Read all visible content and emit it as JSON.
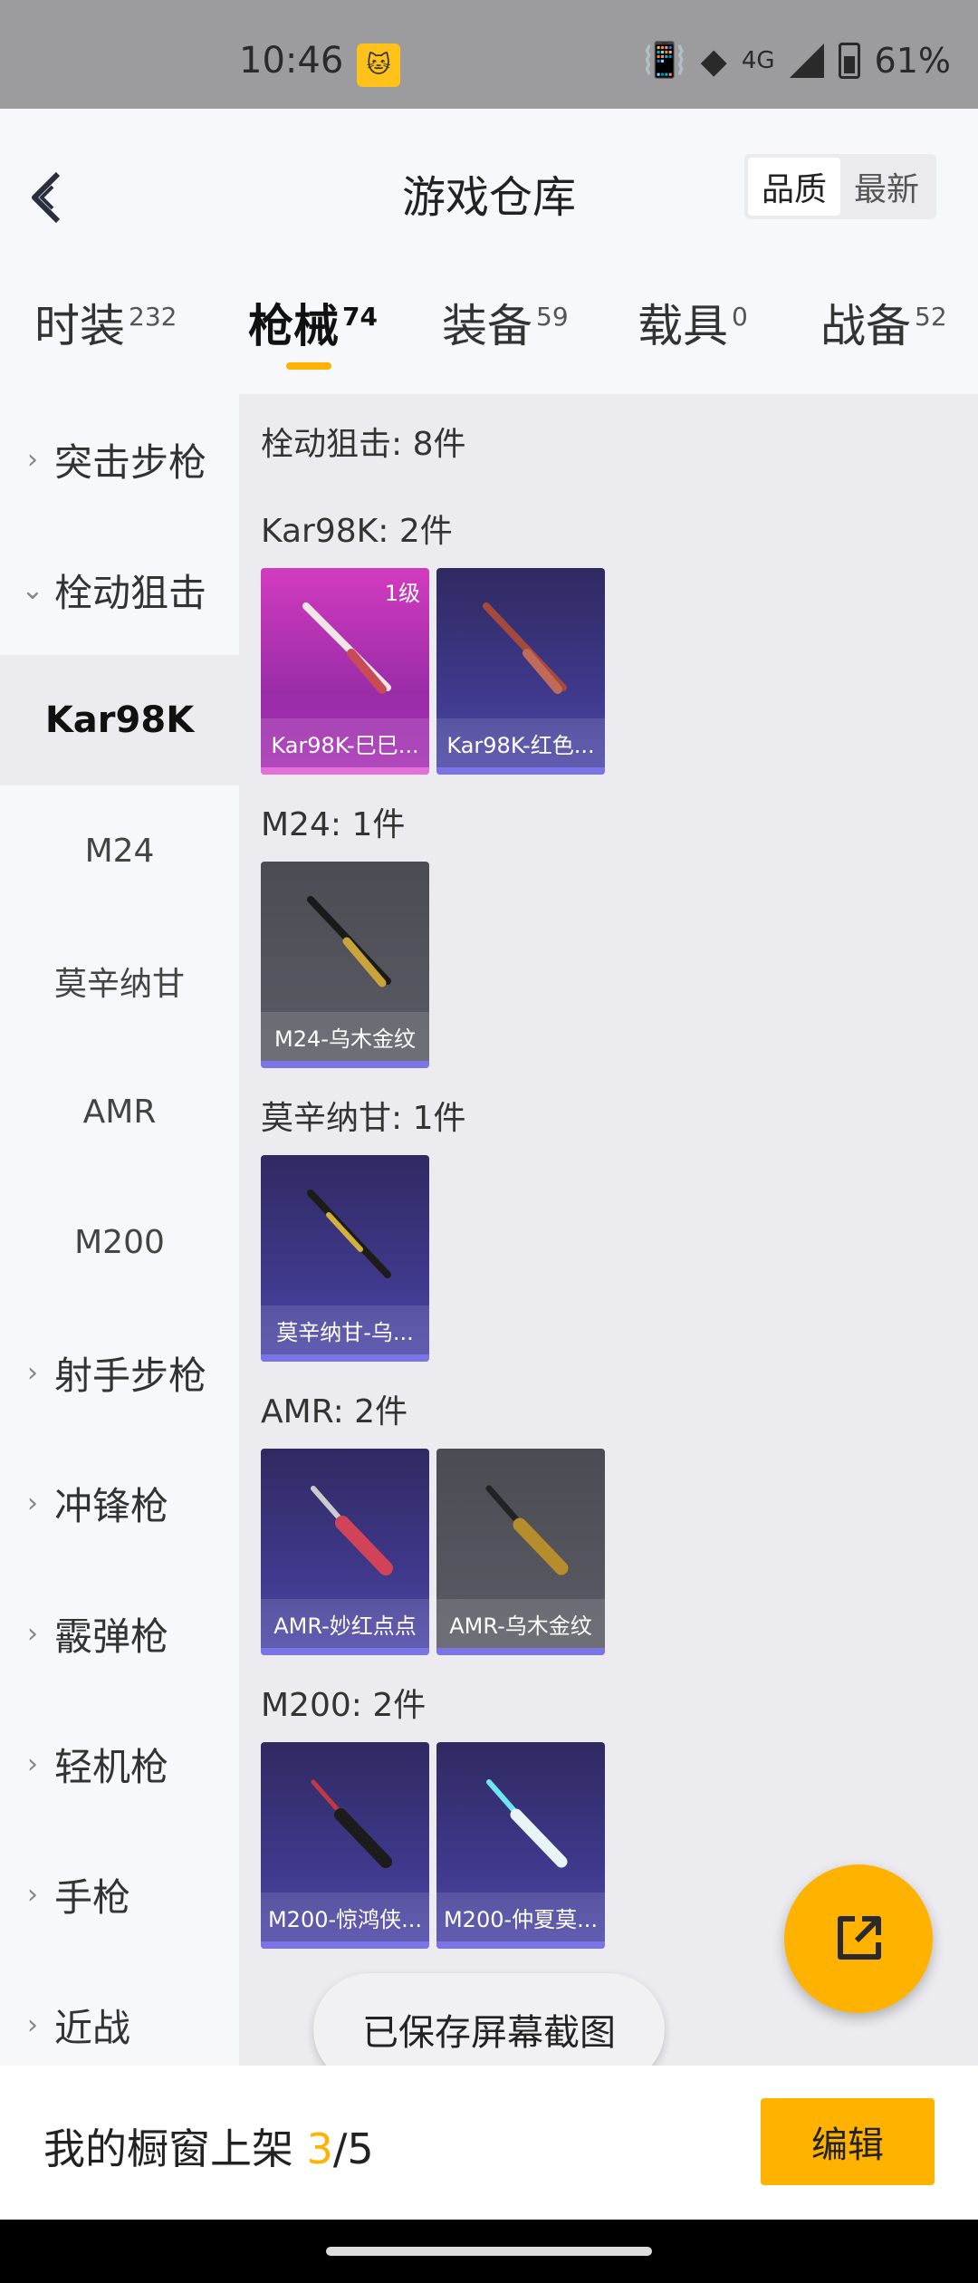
{
  "status": {
    "time": "10:46",
    "network": "4G",
    "battery": "61%",
    "app_icon": "game-app-icon"
  },
  "header": {
    "title": "游戏仓库",
    "sort_options": [
      "品质",
      "最新"
    ],
    "sort_active": "品质"
  },
  "tabs": [
    {
      "label": "时装",
      "count": "232"
    },
    {
      "label": "枪械",
      "count": "74",
      "active": true
    },
    {
      "label": "装备",
      "count": "59"
    },
    {
      "label": "载具",
      "count": "0"
    },
    {
      "label": "战备",
      "count": "52"
    }
  ],
  "sidebar": {
    "categories": [
      "突击步枪",
      "栓动狙击",
      "射手步枪",
      "冲锋枪",
      "霰弹枪",
      "轻机枪",
      "手枪",
      "近战"
    ],
    "subitems": [
      "Kar98K",
      "M24",
      "莫辛纳甘",
      "AMR",
      "M200"
    ],
    "active_sub": "Kar98K"
  },
  "content": {
    "summary": "栓动狙击: 8件",
    "sections": [
      {
        "heading": "Kar98K: 2件",
        "items": [
          {
            "name": "Kar98K-巳巳...",
            "level": "1级",
            "rarity": "pink"
          },
          {
            "name": "Kar98K-红色...",
            "rarity": "purple"
          }
        ]
      },
      {
        "heading": "M24: 1件",
        "items": [
          {
            "name": "M24-乌木金纹",
            "rarity": "gray"
          }
        ]
      },
      {
        "heading": "莫辛纳甘: 1件",
        "items": [
          {
            "name": "莫辛纳甘-乌...",
            "rarity": "purple"
          }
        ]
      },
      {
        "heading": "AMR: 2件",
        "items": [
          {
            "name": "AMR-妙红点点",
            "rarity": "purple"
          },
          {
            "name": "AMR-乌木金纹",
            "rarity": "gray"
          }
        ]
      },
      {
        "heading": "M200: 2件",
        "items": [
          {
            "name": "M200-惊鸿侠...",
            "rarity": "purple"
          },
          {
            "name": "M200-仲夏莫...",
            "rarity": "purple"
          }
        ]
      }
    ]
  },
  "toast": "已保存屏幕截图",
  "bottom": {
    "showcase_label": "我的橱窗上架",
    "showcase_current": "3",
    "showcase_total": "/5",
    "edit_label": "编辑"
  },
  "colors": {
    "accent": "#ffb300",
    "pink_rarity": "#d23bbf",
    "purple_rarity": "#3e3788",
    "gray_rarity": "#5c5c66"
  }
}
